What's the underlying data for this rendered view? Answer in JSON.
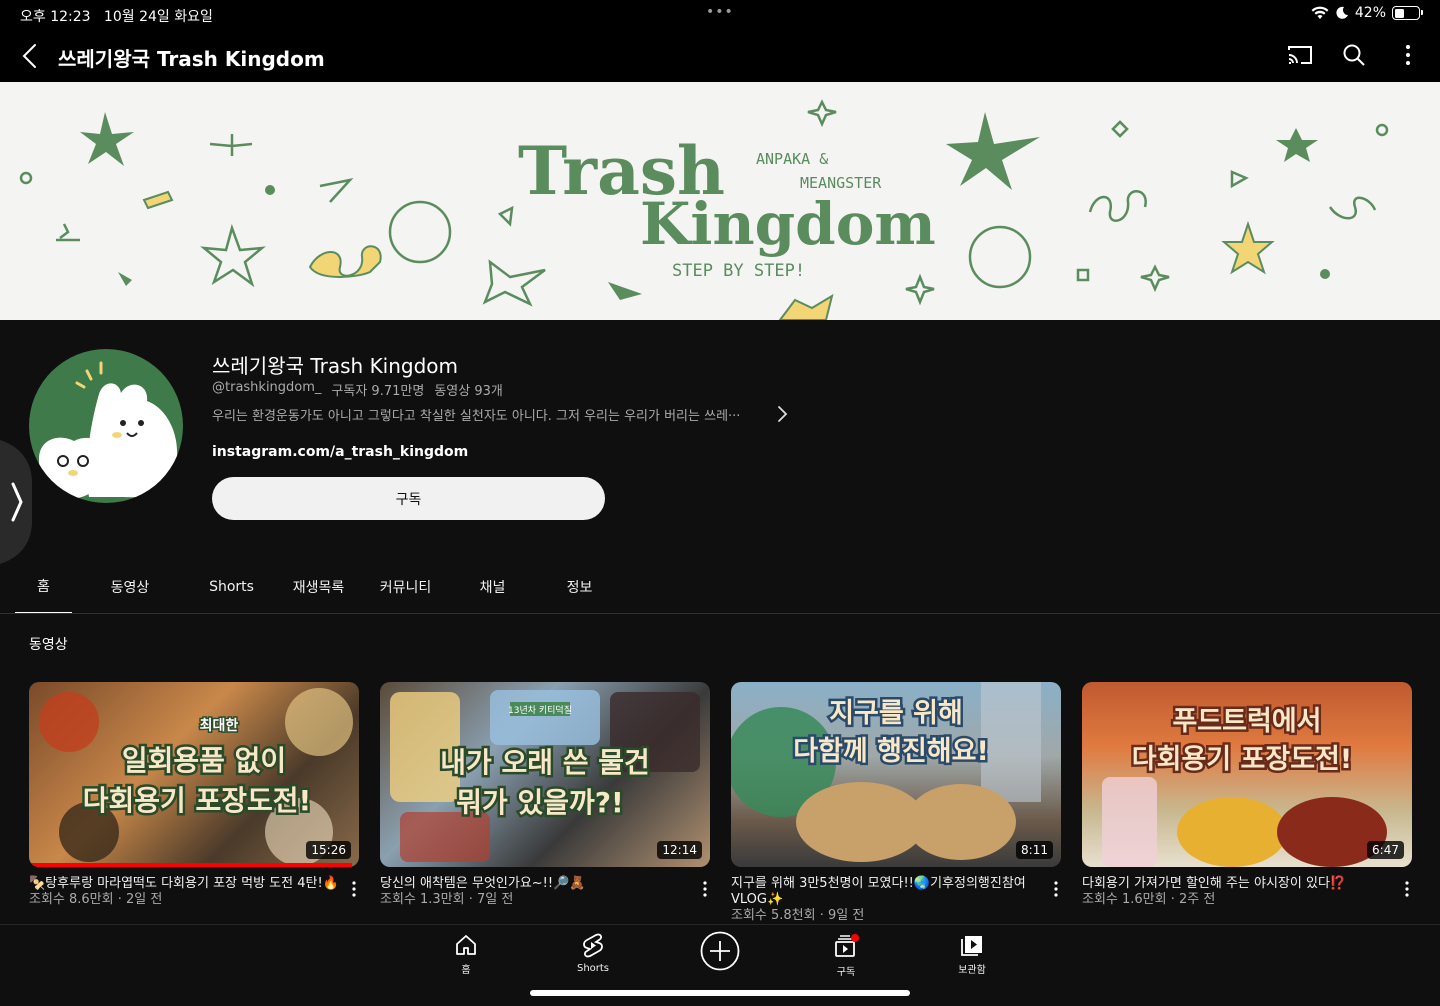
{
  "status": {
    "time": "오후 12:23",
    "date": "10월 24일 화요일",
    "battery": "42%",
    "battery_level": 0.42
  },
  "topbar": {
    "title": "쓰레기왕국 Trash Kingdom"
  },
  "banner": {
    "line1": "Trash",
    "line2": "Kingdom",
    "tag1": "ANPAKA &",
    "tag2": "MEANGSTER",
    "tag3": "STEP BY STEP!"
  },
  "channel": {
    "name": "쓰레기왕국 Trash Kingdom",
    "handle": "@trashkingdom_",
    "subscribers": "구독자 9.71만명",
    "video_count": "동영상 93개",
    "description": "우리는 환경운동가도 아니고 그렇다고 착실한 실천자도 아니다. 그저 우리는 우리가 버리는 쓰레···",
    "link": "instagram.com/a_trash_kingdom",
    "subscribe_label": "구독"
  },
  "tabs": [
    "홈",
    "동영상",
    "Shorts",
    "재생목록",
    "커뮤니티",
    "채널",
    "정보"
  ],
  "section_title": "동영상",
  "videos": [
    {
      "thumb_text1": "최대한",
      "thumb_text2": "일회용품 없이",
      "thumb_text3": "다회용기 포장도전!",
      "duration": "15:26",
      "title": "🍢탕후루랑 마라엽떡도 다회용기 포장 먹방 도전 4탄!🔥",
      "meta": "조회수 8.6만회 · 2일 전",
      "watched": 0.98
    },
    {
      "thumb_text1": "13년차 키티덕질",
      "thumb_text2": "내가 오래 쓴 물건",
      "thumb_text3": "뭐가 있을까?!",
      "duration": "12:14",
      "title": "당신의 애착템은 무엇인가요~!!🔎🧸",
      "meta": "조회수 1.3만회 · 7일 전",
      "watched": 0
    },
    {
      "thumb_text1": "",
      "thumb_text2": "지구를 위해",
      "thumb_text3": "다함께 행진해요!",
      "duration": "8:11",
      "title": "지구를 위해 3만5천명이 모였다!!🌏기후정의행진참여 VLOG✨",
      "meta": "조회수 5.8천회 · 9일 전",
      "watched": 0
    },
    {
      "thumb_text1": "",
      "thumb_text2": "푸드트럭에서",
      "thumb_text3": "다회용기 포장도전!",
      "duration": "6:47",
      "title": "다회용기 가져가면 할인해 주는 야시장이 있다⁉️",
      "meta": "조회수 1.6만회 · 2주 전",
      "watched": 0
    }
  ],
  "bottom_nav": {
    "home": "홈",
    "shorts": "Shorts",
    "subscriptions": "구독",
    "library": "보관함"
  }
}
